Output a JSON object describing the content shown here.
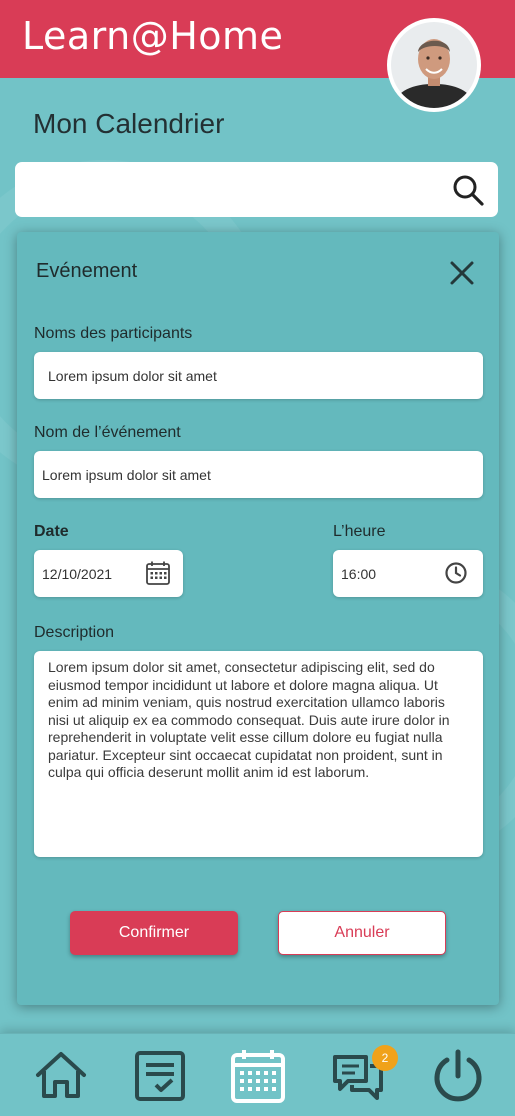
{
  "header": {
    "app_title": "Learn@Home"
  },
  "page": {
    "title": "Mon Calendrier"
  },
  "search": {
    "value": "",
    "placeholder": ""
  },
  "event_dialog": {
    "title": "Evénement",
    "participants_label": "Noms des participants",
    "participants_value": "Lorem ipsum dolor sit amet",
    "event_name_label": "Nom de l’événement",
    "event_name_value": "Lorem ipsum dolor sit amet",
    "date_label": "Date",
    "date_value": "12/10/2021",
    "time_label": "L’heure",
    "time_value": "16:00",
    "description_label": "Description",
    "description_value": "Lorem ipsum dolor sit amet, consectetur adipiscing elit, sed do eiusmod tempor incididunt ut labore et dolore magna aliqua. Ut enim ad minim veniam, quis nostrud exercitation ullamco laboris nisi ut aliquip ex ea commodo consequat. Duis aute irure dolor in reprehenderit in voluptate velit esse cillum dolore eu fugiat nulla pariatur. Excepteur sint occaecat cupidatat non proident, sunt in culpa qui officia deserunt mollit anim id est laborum.",
    "confirm_label": "Confirmer",
    "cancel_label": "Annuler"
  },
  "bottom_nav": {
    "items": [
      {
        "icon": "home-icon"
      },
      {
        "icon": "tasks-icon"
      },
      {
        "icon": "calendar-icon",
        "active": true
      },
      {
        "icon": "chat-icon"
      },
      {
        "icon": "power-icon"
      }
    ],
    "chat_badge": "2"
  },
  "colors": {
    "brand_red": "#d93c56",
    "teal_background": "#72c3c7",
    "nav_icon": "#2a4a4c",
    "badge": "#f0a21a"
  }
}
